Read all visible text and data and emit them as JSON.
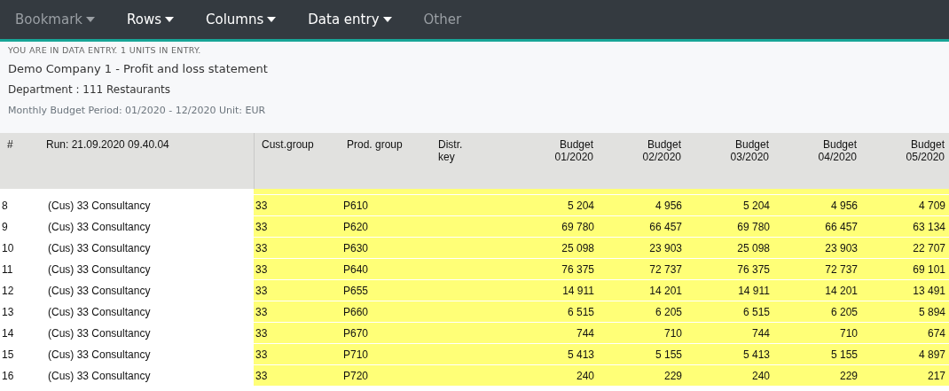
{
  "menu": [
    {
      "label": "Bookmark",
      "dropdown": true,
      "disabled": true
    },
    {
      "label": "Rows",
      "dropdown": true,
      "disabled": false
    },
    {
      "label": "Columns",
      "dropdown": true,
      "disabled": false
    },
    {
      "label": "Data entry",
      "dropdown": true,
      "disabled": false
    },
    {
      "label": "Other",
      "dropdown": false,
      "disabled": true
    }
  ],
  "info": {
    "notice": "YOU ARE IN DATA ENTRY. 1 UNITS IN ENTRY.",
    "title": "Demo Company 1 - Profit and loss statement",
    "department": "Department : 111 Restaurants",
    "period": "Monthly Budget Period: 01/2020 - 12/2020 Unit: EUR"
  },
  "table": {
    "columns": [
      "#",
      "Run: 21.09.2020 09.40.04",
      "Cust.group",
      "Prod. group",
      "Distr.\nkey",
      "Budget\n01/2020",
      "Budget\n02/2020",
      "Budget\n03/2020",
      "Budget\n04/2020",
      "Budget\n05/2020"
    ],
    "rows": [
      [
        "8",
        "(Cus) 33 Consultancy",
        "33",
        "P610",
        "",
        "5 204",
        "4 956",
        "5 204",
        "4 956",
        "4 709"
      ],
      [
        "9",
        "(Cus) 33 Consultancy",
        "33",
        "P620",
        "",
        "69 780",
        "66 457",
        "69 780",
        "66 457",
        "63 134"
      ],
      [
        "10",
        "(Cus) 33 Consultancy",
        "33",
        "P630",
        "",
        "25 098",
        "23 903",
        "25 098",
        "23 903",
        "22 707"
      ],
      [
        "11",
        "(Cus) 33 Consultancy",
        "33",
        "P640",
        "",
        "76 375",
        "72 737",
        "76 375",
        "72 737",
        "69 101"
      ],
      [
        "12",
        "(Cus) 33 Consultancy",
        "33",
        "P655",
        "",
        "14 911",
        "14 201",
        "14 911",
        "14 201",
        "13 491"
      ],
      [
        "13",
        "(Cus) 33 Consultancy",
        "33",
        "P660",
        "",
        "6 515",
        "6 205",
        "6 515",
        "6 205",
        "5 894"
      ],
      [
        "14",
        "(Cus) 33 Consultancy",
        "33",
        "P670",
        "",
        "744",
        "710",
        "744",
        "710",
        "674"
      ],
      [
        "15",
        "(Cus) 33 Consultancy",
        "33",
        "P710",
        "",
        "5 413",
        "5 155",
        "5 413",
        "5 155",
        "4 897"
      ],
      [
        "16",
        "(Cus) 33 Consultancy",
        "33",
        "P720",
        "",
        "240",
        "229",
        "240",
        "229",
        "217"
      ]
    ]
  }
}
